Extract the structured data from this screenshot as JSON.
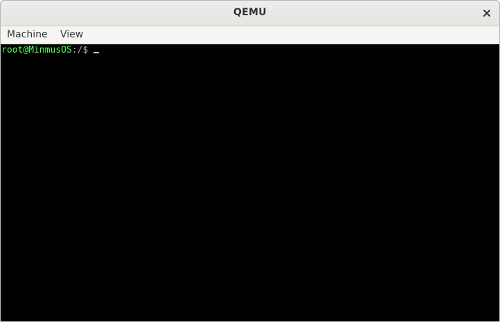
{
  "window": {
    "title": "QEMU",
    "close_icon": "close-icon"
  },
  "menubar": {
    "items": [
      {
        "label": "Machine"
      },
      {
        "label": "View"
      }
    ]
  },
  "terminal": {
    "prompt_user_host": "root@MinmusOS",
    "prompt_path": ":/$",
    "colors": {
      "background": "#000000",
      "prompt_user_host": "#54fc54",
      "prompt_path": "#a8a8a8",
      "cursor": "#c8c8c8"
    }
  }
}
